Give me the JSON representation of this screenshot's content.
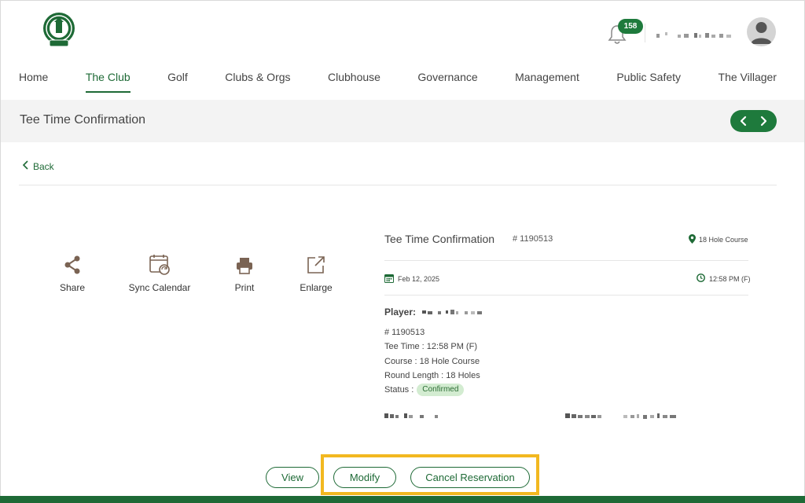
{
  "header": {
    "logo_icon": "villages-seal-logo",
    "notifications": {
      "icon": "bell-icon",
      "count": "158"
    },
    "avatar_icon": "user-avatar-icon"
  },
  "nav": {
    "items": [
      {
        "label": "Home",
        "active": false
      },
      {
        "label": "The Club",
        "active": true
      },
      {
        "label": "Golf",
        "active": false
      },
      {
        "label": "Clubs & Orgs",
        "active": false
      },
      {
        "label": "Clubhouse",
        "active": false
      },
      {
        "label": "Governance",
        "active": false
      },
      {
        "label": "Management",
        "active": false
      },
      {
        "label": "Public Safety",
        "active": false
      },
      {
        "label": "The Villager",
        "active": false
      }
    ]
  },
  "titlebar": {
    "title": "Tee Time Confirmation",
    "prev_icon": "chevron-left-icon",
    "next_icon": "chevron-right-icon"
  },
  "back": {
    "label": "Back"
  },
  "actions": [
    {
      "label": "Share",
      "icon": "share-icon"
    },
    {
      "label": "Sync Calendar",
      "icon": "calendar-sync-icon"
    },
    {
      "label": "Print",
      "icon": "printer-icon"
    },
    {
      "label": "Enlarge",
      "icon": "external-link-icon"
    }
  ],
  "card": {
    "title": "Tee Time Confirmation",
    "number": "# 1190513",
    "course": "18 Hole Course",
    "date": "Feb 12, 2025",
    "time": "12:58 PM (F)",
    "player_label": "Player:",
    "detail_number": "# 1190513",
    "tee_time": "Tee Time : 12:58 PM (F)",
    "course_line": "Course : 18 Hole Course",
    "round_length": "Round Length : 18 Holes",
    "status_label": "Status :",
    "status_value": "Confirmed"
  },
  "buttons": {
    "view": "View",
    "modify": "Modify",
    "cancel": "Cancel Reservation"
  },
  "colors": {
    "brand_green": "#1e6a36",
    "badge_green": "#1e7a3c",
    "highlight": "#f2b820",
    "status_bg": "#d3ecd1"
  }
}
